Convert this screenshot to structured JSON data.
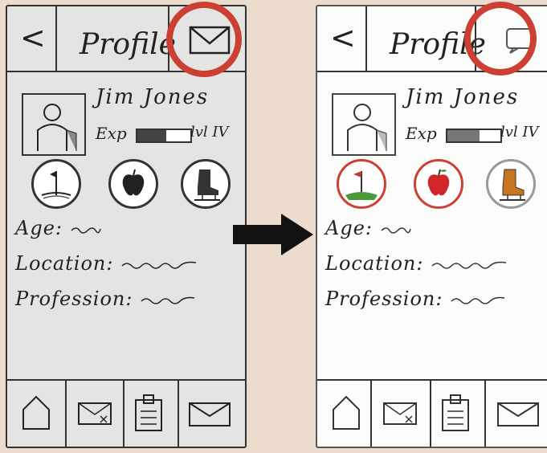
{
  "screens": [
    {
      "title": "Profile",
      "back_label": "<",
      "corner_icon": "mail-icon",
      "name": "Jim Jones",
      "exp_label": "Exp",
      "exp_fraction": 0.55,
      "level_label": "lvl IV",
      "badges": [
        "golf-flag-icon",
        "apple-icon",
        "ice-skate-icon"
      ],
      "fields": {
        "age": "Age:",
        "location": "Location:",
        "profession": "Profession:"
      },
      "bottom_nav": [
        "home-icon",
        "message-card-icon",
        "clipboard-icon",
        "mail-icon"
      ]
    },
    {
      "title": "Profile",
      "back_label": "<",
      "corner_icon": "chat-bubble-icon",
      "name": "Jim Jones",
      "exp_label": "Exp",
      "exp_fraction": 0.6,
      "level_label": "lvl IV",
      "badges": [
        "golf-flag-icon",
        "apple-icon",
        "ice-skate-icon"
      ],
      "fields": {
        "age": "Age:",
        "location": "Location:",
        "profession": "Profession:"
      },
      "bottom_nav": [
        "home-icon",
        "message-card-icon",
        "clipboard-icon",
        "mail-icon"
      ]
    }
  ],
  "colors": {
    "highlight": "#cc3f33",
    "arrow": "#111111",
    "flag": "#c0392b",
    "grass": "#4a9a3a",
    "skate": "#c8761e"
  }
}
